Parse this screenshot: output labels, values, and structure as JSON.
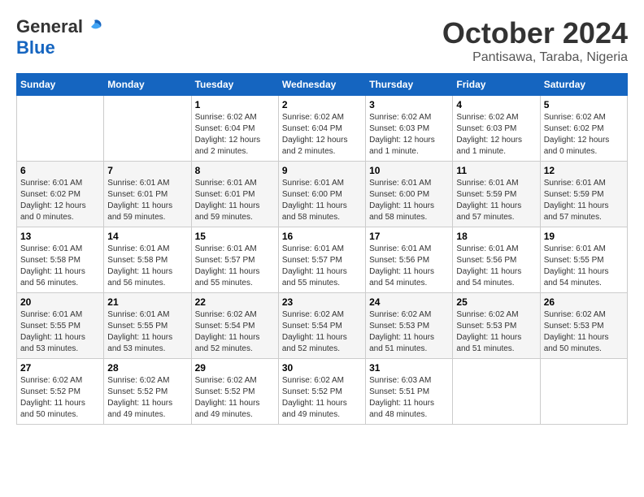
{
  "header": {
    "logo_general": "General",
    "logo_blue": "Blue",
    "month_title": "October 2024",
    "subtitle": "Pantisawa, Taraba, Nigeria"
  },
  "calendar": {
    "days_of_week": [
      "Sunday",
      "Monday",
      "Tuesday",
      "Wednesday",
      "Thursday",
      "Friday",
      "Saturday"
    ],
    "weeks": [
      [
        {
          "day": "",
          "info": ""
        },
        {
          "day": "",
          "info": ""
        },
        {
          "day": "1",
          "info": "Sunrise: 6:02 AM\nSunset: 6:04 PM\nDaylight: 12 hours\nand 2 minutes."
        },
        {
          "day": "2",
          "info": "Sunrise: 6:02 AM\nSunset: 6:04 PM\nDaylight: 12 hours\nand 2 minutes."
        },
        {
          "day": "3",
          "info": "Sunrise: 6:02 AM\nSunset: 6:03 PM\nDaylight: 12 hours\nand 1 minute."
        },
        {
          "day": "4",
          "info": "Sunrise: 6:02 AM\nSunset: 6:03 PM\nDaylight: 12 hours\nand 1 minute."
        },
        {
          "day": "5",
          "info": "Sunrise: 6:02 AM\nSunset: 6:02 PM\nDaylight: 12 hours\nand 0 minutes."
        }
      ],
      [
        {
          "day": "6",
          "info": "Sunrise: 6:01 AM\nSunset: 6:02 PM\nDaylight: 12 hours\nand 0 minutes."
        },
        {
          "day": "7",
          "info": "Sunrise: 6:01 AM\nSunset: 6:01 PM\nDaylight: 11 hours\nand 59 minutes."
        },
        {
          "day": "8",
          "info": "Sunrise: 6:01 AM\nSunset: 6:01 PM\nDaylight: 11 hours\nand 59 minutes."
        },
        {
          "day": "9",
          "info": "Sunrise: 6:01 AM\nSunset: 6:00 PM\nDaylight: 11 hours\nand 58 minutes."
        },
        {
          "day": "10",
          "info": "Sunrise: 6:01 AM\nSunset: 6:00 PM\nDaylight: 11 hours\nand 58 minutes."
        },
        {
          "day": "11",
          "info": "Sunrise: 6:01 AM\nSunset: 5:59 PM\nDaylight: 11 hours\nand 57 minutes."
        },
        {
          "day": "12",
          "info": "Sunrise: 6:01 AM\nSunset: 5:59 PM\nDaylight: 11 hours\nand 57 minutes."
        }
      ],
      [
        {
          "day": "13",
          "info": "Sunrise: 6:01 AM\nSunset: 5:58 PM\nDaylight: 11 hours\nand 56 minutes."
        },
        {
          "day": "14",
          "info": "Sunrise: 6:01 AM\nSunset: 5:58 PM\nDaylight: 11 hours\nand 56 minutes."
        },
        {
          "day": "15",
          "info": "Sunrise: 6:01 AM\nSunset: 5:57 PM\nDaylight: 11 hours\nand 55 minutes."
        },
        {
          "day": "16",
          "info": "Sunrise: 6:01 AM\nSunset: 5:57 PM\nDaylight: 11 hours\nand 55 minutes."
        },
        {
          "day": "17",
          "info": "Sunrise: 6:01 AM\nSunset: 5:56 PM\nDaylight: 11 hours\nand 54 minutes."
        },
        {
          "day": "18",
          "info": "Sunrise: 6:01 AM\nSunset: 5:56 PM\nDaylight: 11 hours\nand 54 minutes."
        },
        {
          "day": "19",
          "info": "Sunrise: 6:01 AM\nSunset: 5:55 PM\nDaylight: 11 hours\nand 54 minutes."
        }
      ],
      [
        {
          "day": "20",
          "info": "Sunrise: 6:01 AM\nSunset: 5:55 PM\nDaylight: 11 hours\nand 53 minutes."
        },
        {
          "day": "21",
          "info": "Sunrise: 6:01 AM\nSunset: 5:55 PM\nDaylight: 11 hours\nand 53 minutes."
        },
        {
          "day": "22",
          "info": "Sunrise: 6:02 AM\nSunset: 5:54 PM\nDaylight: 11 hours\nand 52 minutes."
        },
        {
          "day": "23",
          "info": "Sunrise: 6:02 AM\nSunset: 5:54 PM\nDaylight: 11 hours\nand 52 minutes."
        },
        {
          "day": "24",
          "info": "Sunrise: 6:02 AM\nSunset: 5:53 PM\nDaylight: 11 hours\nand 51 minutes."
        },
        {
          "day": "25",
          "info": "Sunrise: 6:02 AM\nSunset: 5:53 PM\nDaylight: 11 hours\nand 51 minutes."
        },
        {
          "day": "26",
          "info": "Sunrise: 6:02 AM\nSunset: 5:53 PM\nDaylight: 11 hours\nand 50 minutes."
        }
      ],
      [
        {
          "day": "27",
          "info": "Sunrise: 6:02 AM\nSunset: 5:52 PM\nDaylight: 11 hours\nand 50 minutes."
        },
        {
          "day": "28",
          "info": "Sunrise: 6:02 AM\nSunset: 5:52 PM\nDaylight: 11 hours\nand 49 minutes."
        },
        {
          "day": "29",
          "info": "Sunrise: 6:02 AM\nSunset: 5:52 PM\nDaylight: 11 hours\nand 49 minutes."
        },
        {
          "day": "30",
          "info": "Sunrise: 6:02 AM\nSunset: 5:52 PM\nDaylight: 11 hours\nand 49 minutes."
        },
        {
          "day": "31",
          "info": "Sunrise: 6:03 AM\nSunset: 5:51 PM\nDaylight: 11 hours\nand 48 minutes."
        },
        {
          "day": "",
          "info": ""
        },
        {
          "day": "",
          "info": ""
        }
      ]
    ]
  }
}
